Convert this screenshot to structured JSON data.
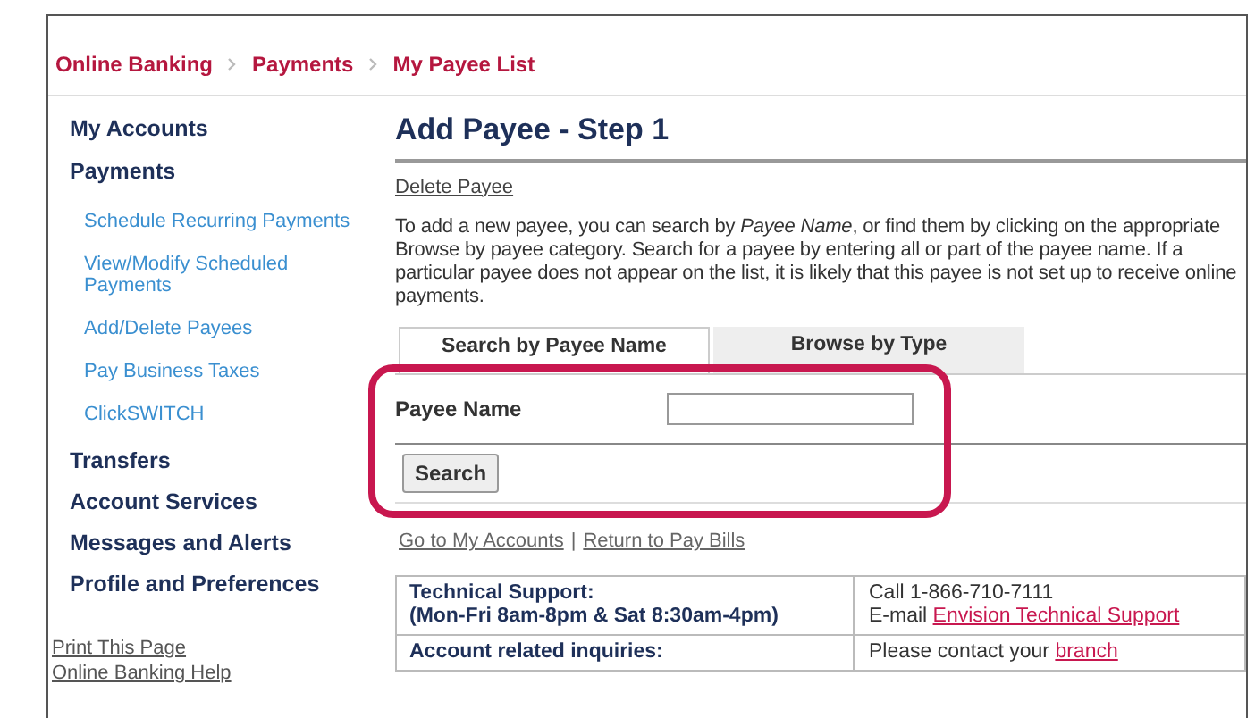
{
  "breadcrumb": [
    "Online Banking",
    "Payments",
    "My Payee List"
  ],
  "sidebar": {
    "items": [
      {
        "label": "My Accounts",
        "kind": "section"
      },
      {
        "label": "Payments",
        "kind": "section"
      },
      {
        "label": "Schedule Recurring Payments",
        "kind": "sub"
      },
      {
        "label": "View/Modify Scheduled Payments",
        "kind": "sub"
      },
      {
        "label": "Add/Delete Payees",
        "kind": "sub"
      },
      {
        "label": "Pay Business Taxes",
        "kind": "sub"
      },
      {
        "label": "ClickSWITCH",
        "kind": "sub"
      },
      {
        "label": "Transfers",
        "kind": "section"
      },
      {
        "label": "Account Services",
        "kind": "section"
      },
      {
        "label": "Messages and Alerts",
        "kind": "section"
      },
      {
        "label": "Profile and Preferences",
        "kind": "section"
      }
    ],
    "links": [
      "Print This Page",
      "Online Banking Help"
    ]
  },
  "title": "Add Payee - Step 1",
  "delete_link": "Delete Payee",
  "description": "To add a new payee, you can search by *Payee Name*, or find them by clicking on the appropriate Browse by payee category. Search for a payee by entering all or part of the payee name. If a particular payee does not appear on the list, it is likely that this payee is not set up to receive online payments.",
  "tabs": [
    {
      "label": "Search by Payee Name",
      "selected": true
    },
    {
      "label": "Browse by Type",
      "selected": false
    }
  ],
  "form": {
    "label": "Payee Name",
    "button": "Search"
  },
  "nav_links": [
    "Go to My Accounts",
    "Return to Pay Bills"
  ],
  "nav_separator": "|",
  "support_table": [
    {
      "label": [
        "Technical Support:",
        "(Mon-Fri 8am-8pm & Sat 8:30am-4pm)"
      ],
      "info": [
        "Call 1-866-710-7111"
      ],
      "info_prefix": "E-mail ",
      "info_link": "Envision Technical Support"
    },
    {
      "label": [
        "Account related inquiries:"
      ],
      "info_prefix": "Please contact your ",
      "info_link": "branch"
    }
  ]
}
